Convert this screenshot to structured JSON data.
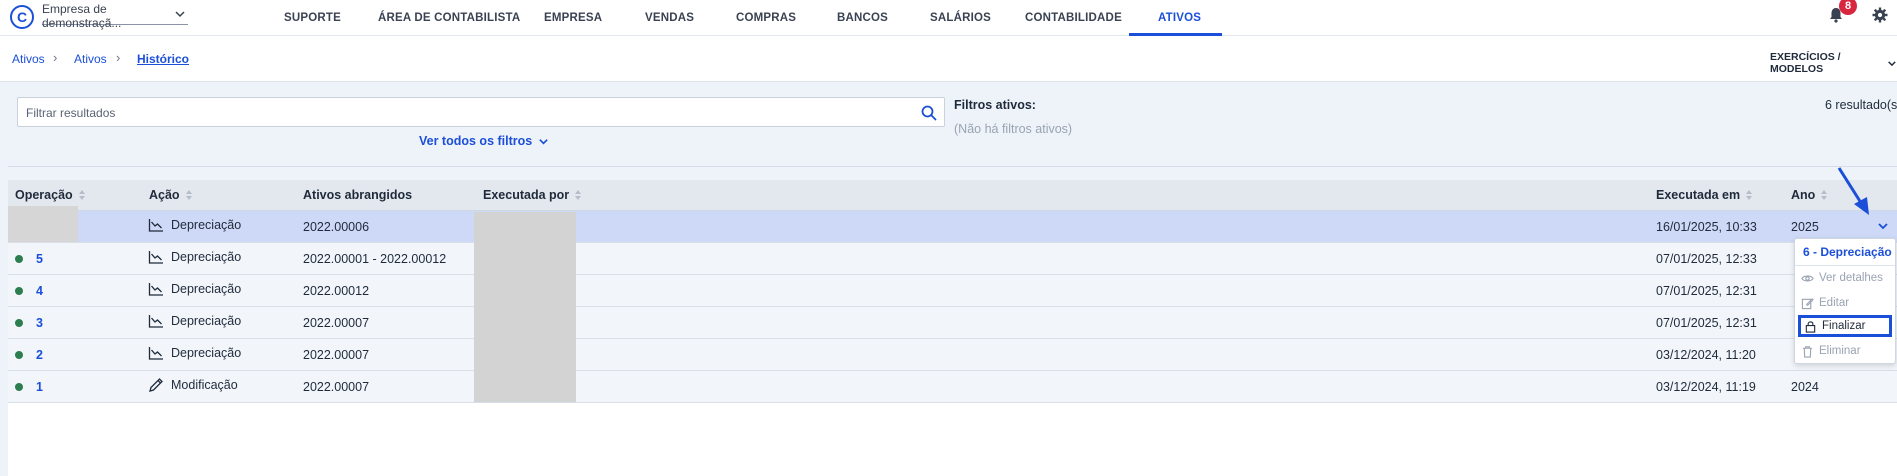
{
  "brand": {
    "logo_letter": "C",
    "company": "Empresa de demonstraçã..."
  },
  "nav": {
    "items": [
      {
        "label": "SUPORTE"
      },
      {
        "label": "ÁREA DE CONTABILISTA"
      },
      {
        "label": "EMPRESA"
      },
      {
        "label": "VENDAS"
      },
      {
        "label": "COMPRAS"
      },
      {
        "label": "BANCOS"
      },
      {
        "label": "SALÁRIOS"
      },
      {
        "label": "CONTABILIDADE"
      },
      {
        "label": "ATIVOS"
      }
    ],
    "active": "ATIVOS",
    "notification_count": "8"
  },
  "breadcrumb": {
    "items": [
      "Ativos",
      "Ativos",
      "Histórico"
    ],
    "right_action": "EXERCÍCIOS / MODELOS"
  },
  "filters": {
    "search_placeholder": "Filtrar resultados",
    "see_all": "Ver todos os filtros",
    "active_label": "Filtros ativos:",
    "none_active": "(Não há filtros ativos)",
    "results": "6 resultado(s"
  },
  "table": {
    "columns": [
      "Operação",
      "Ação",
      "Ativos abrangidos",
      "Executada por",
      "Executada em",
      "Ano"
    ],
    "rows": [
      {
        "op": "",
        "action": "Depreciação",
        "action_icon": "depreciation-chart-icon",
        "assets": "2022.00006",
        "executed_by": "",
        "executed_at": "16/01/2025, 10:33",
        "year": "2025",
        "selected": true
      },
      {
        "op": "5",
        "action": "Depreciação",
        "action_icon": "depreciation-chart-icon",
        "assets": "2022.00001 - 2022.00012",
        "executed_by": "",
        "executed_at": "07/01/2025, 12:33",
        "year": ""
      },
      {
        "op": "4",
        "action": "Depreciação",
        "action_icon": "depreciation-chart-icon",
        "assets": "2022.00012",
        "executed_by": "",
        "executed_at": "07/01/2025, 12:31",
        "year": ""
      },
      {
        "op": "3",
        "action": "Depreciação",
        "action_icon": "depreciation-chart-icon",
        "assets": "2022.00007",
        "executed_by": "",
        "executed_at": "07/01/2025, 12:31",
        "year": ""
      },
      {
        "op": "2",
        "action": "Depreciação",
        "action_icon": "depreciation-chart-icon",
        "assets": "2022.00007",
        "executed_by": "",
        "executed_at": "03/12/2024, 11:20",
        "year": ""
      },
      {
        "op": "1",
        "action": "Modificação",
        "action_icon": "pencil-icon",
        "assets": "2022.00007",
        "executed_by": "",
        "executed_at": "03/12/2024, 11:19",
        "year": "2024"
      }
    ]
  },
  "context_menu": {
    "title": "6 - Depreciação",
    "items": [
      {
        "label": "Ver detalhes",
        "icon": "eye-icon"
      },
      {
        "label": "Editar",
        "icon": "edit-icon"
      },
      {
        "label": "Finalizar",
        "icon": "lock-icon",
        "highlighted": true
      },
      {
        "label": "Eliminar",
        "icon": "trash-icon"
      }
    ]
  },
  "colors": {
    "accent": "#1b4fd8",
    "status_dot": "#2e7d4f",
    "badge": "#d7263d",
    "selected_row": "#cdd9f7"
  }
}
